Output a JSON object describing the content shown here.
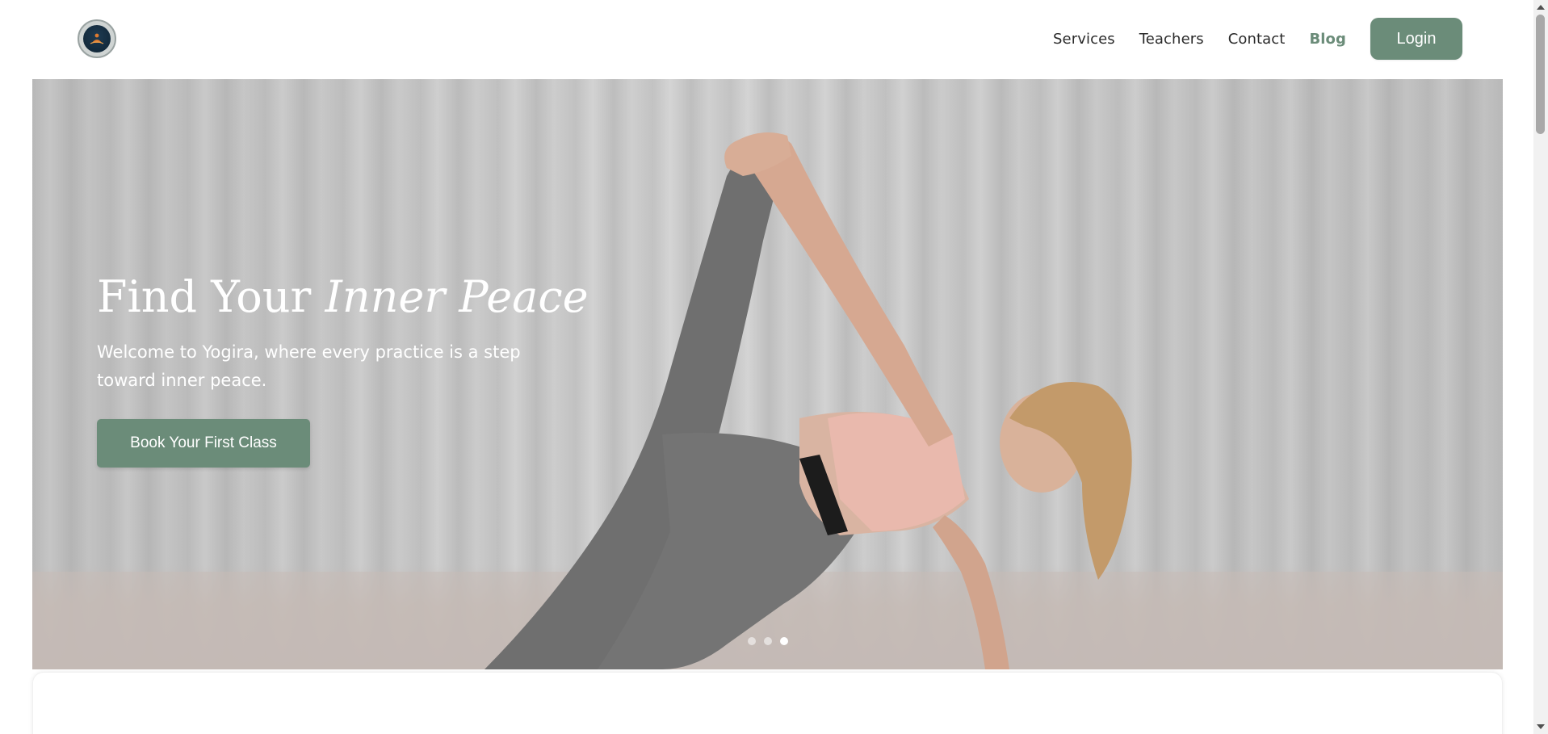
{
  "header": {
    "logo_icon": "lotus-meditation-logo-icon",
    "nav": [
      {
        "label": "Services",
        "active": false
      },
      {
        "label": "Teachers",
        "active": false
      },
      {
        "label": "Contact",
        "active": false
      },
      {
        "label": "Blog",
        "active": true
      }
    ],
    "login_label": "Login"
  },
  "hero": {
    "title_plain": "Find Your ",
    "title_emphasis": "Inner Peace",
    "subtitle": "Welcome to Yogira, where every practice is a step toward inner peace.",
    "cta_label": "Book Your First Class",
    "image_subject": "woman-yoga-pose-image",
    "carousel": {
      "total": 3,
      "active_index": 3
    }
  },
  "colors": {
    "accent": "#6b8c79",
    "text": "#2a2a2a",
    "hero_text": "#ffffff"
  }
}
